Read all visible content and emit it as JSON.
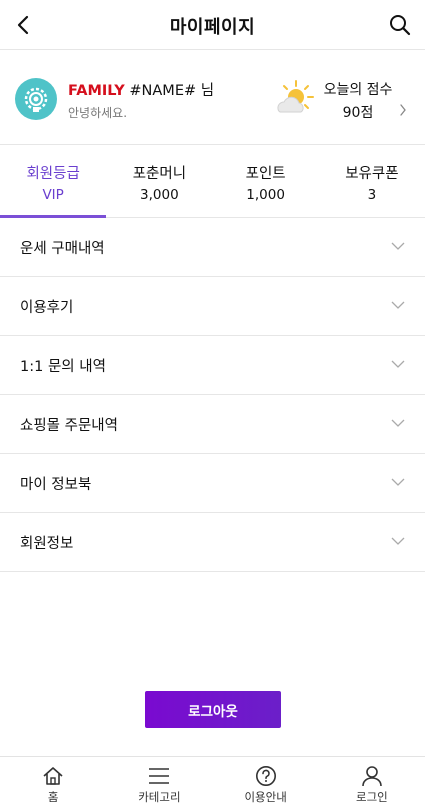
{
  "header": {
    "title": "마이페이지",
    "back_icon": "chevron-left-icon",
    "search_icon": "search-icon"
  },
  "profile": {
    "grade": "FAMILY",
    "name": "#NAME#",
    "suffix": "님",
    "greeting": "안녕하세요.",
    "score_label": "오늘의 점수",
    "score_value": "90점",
    "weather_icon": "sun-cloud-icon",
    "avatar_icon": "gear-avatar-icon"
  },
  "tabs": [
    {
      "label": "회원등급",
      "value": "VIP",
      "active": true
    },
    {
      "label": "포춘머니",
      "value": "3,000",
      "active": false
    },
    {
      "label": "포인트",
      "value": "1,000",
      "active": false
    },
    {
      "label": "보유쿠폰",
      "value": "3",
      "active": false
    }
  ],
  "menu": [
    {
      "label": "운세 구매내역"
    },
    {
      "label": "이용후기"
    },
    {
      "label": "1:1 문의 내역"
    },
    {
      "label": "쇼핑몰 주문내역"
    },
    {
      "label": "마이 정보북"
    },
    {
      "label": "회원정보"
    }
  ],
  "logout_label": "로그아웃",
  "bottom_nav": [
    {
      "label": "홈",
      "icon": "home-icon"
    },
    {
      "label": "카테고리",
      "icon": "menu-icon"
    },
    {
      "label": "이용안내",
      "icon": "help-icon"
    },
    {
      "label": "로그인",
      "icon": "user-icon"
    }
  ],
  "colors": {
    "accent": "#7b4fd6",
    "grade": "#d50f1d",
    "avatar": "#4fc3c8",
    "logout": "#7a0ad0"
  }
}
